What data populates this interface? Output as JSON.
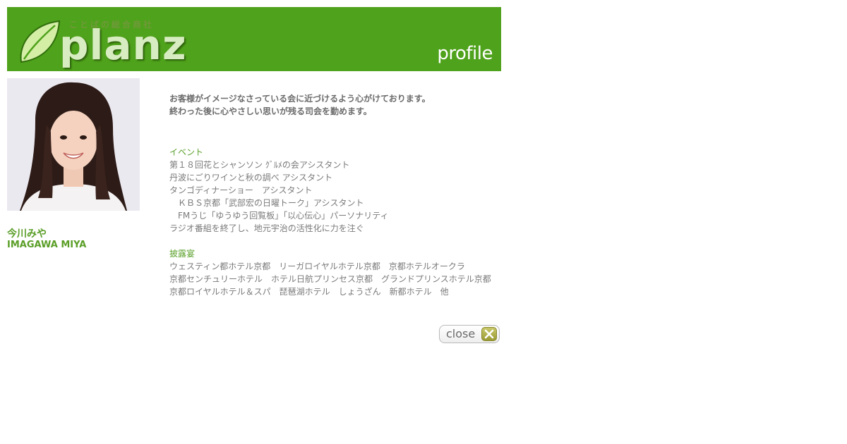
{
  "header": {
    "logo_tagline": "ことばの総合商社",
    "logo_word": "planz",
    "page_title": "profile",
    "colors": {
      "banner": "#4fa21b",
      "logo_leaf": "#d4eea6"
    }
  },
  "profile": {
    "photo_icon": "portrait-photo",
    "name_ja": "今川みや",
    "name_en": "IMAGAWA MIYA",
    "name_color": "#5a9e27"
  },
  "intro": {
    "lines": [
      "お客様がイメージなさっている会に近づけるよう心がけております。",
      "終わった後に心やさしい思いが残る司会を勤めます。"
    ]
  },
  "sections": {
    "events": {
      "title": "イベント",
      "lines": [
        "第１８回花とシャンソン ｸﾞﾙﾒの会アシスタント",
        "丹波にごりワインと秋の調べ アシスタント",
        "タンゴディナーショー　アシスタント",
        "　ＫＢＳ京都「武部宏の日曜トーク」アシスタント",
        "　FMうじ「ゆうゆう回覧板」「以心伝心」パーソナリティ",
        "ラジオ番組を終了し、地元宇治の活性化に力を注ぐ"
      ]
    },
    "weddings": {
      "title": "披露宴",
      "lines": [
        "ウェスティン都ホテル京都　リーガロイヤルホテル京都　京都ホテルオークラ",
        "京都センチュリーホテル　ホテル日航プリンセス京都　グランドプリンスホテル京都",
        "京都ロイヤルホテル＆スパ　琵琶湖ホテル　しょうざん　新都ホテル　他"
      ]
    }
  },
  "close_button": {
    "label": "close",
    "icon": "close-x-icon"
  }
}
